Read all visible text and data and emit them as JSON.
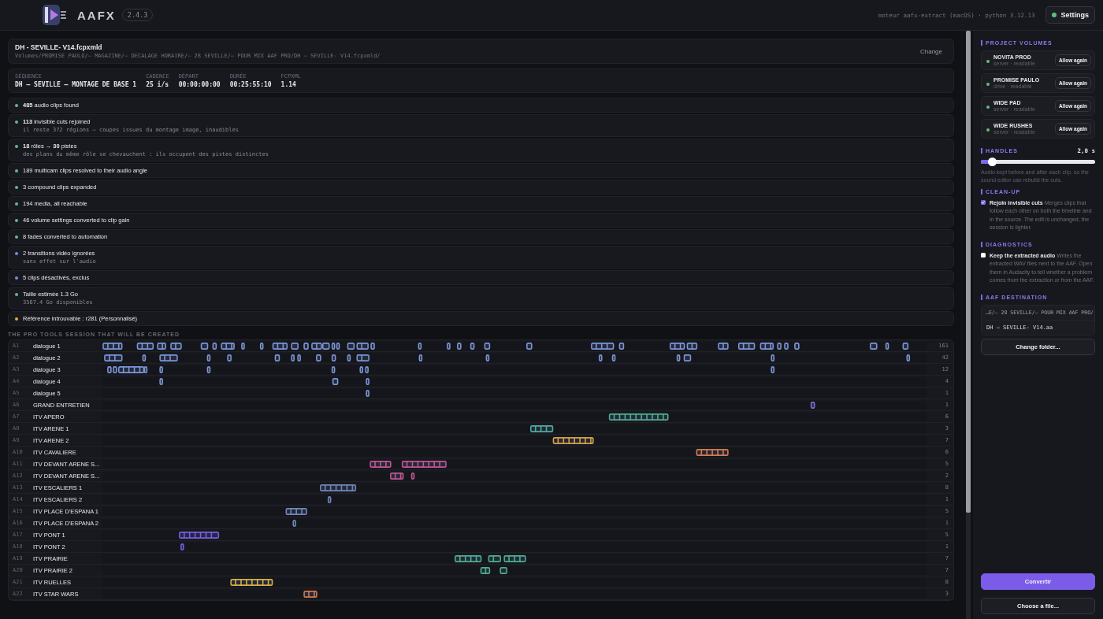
{
  "header": {
    "app_name": "AAFX",
    "version": "2.4.3",
    "engine": "moteur aafx-extract (macOS) · python 3.12.13",
    "settings": {
      "label": "Settings",
      "color": "#5fbf7f"
    }
  },
  "file": {
    "name": "DH - SEVILLE- V14.fcpxmld",
    "path": "Volumes/PROMISE PAULO/— MAGAZINE/— DECALAGE HORAIRE/— 28 SEVILLE/— POUR MIX AAF PRO/DH — SEVILLE- V14.fcpxmld/",
    "change": "Change"
  },
  "sequence": [
    {
      "label": "SÉQUENCE",
      "value": "DH — SEVILLE — MONTAGE DE BASE 1"
    },
    {
      "label": "CADENCE",
      "value": "25 i/s"
    },
    {
      "label": "DÉPART",
      "value": "00:00:00:00"
    },
    {
      "label": "DURÉE",
      "value": "00:25:55:10"
    },
    {
      "label": "FCPXML",
      "value": "1.14"
    }
  ],
  "report": [
    {
      "text": "**485** audio clips found",
      "color": "#5fbf7f"
    },
    {
      "text": "**113** invisible cuts rejoined",
      "detail": "il reste 372 régions — coupes issues du montage image, inaudibles",
      "color": "#5fbf7f"
    },
    {
      "text": "**18** rôles → **30** pistes",
      "detail": "des plans du même rôle se chevauchent : ils occupent des pistes distinctes",
      "color": "#5fbf7f"
    },
    {
      "text": "189 multicam clips resolved to their audio angle",
      "color": "#5fbf7f"
    },
    {
      "text": "3 compound clips expanded",
      "color": "#5fbf7f"
    },
    {
      "text": "194 media, all reachable",
      "color": "#5fbf7f"
    },
    {
      "text": "46 volume settings converted to clip gain",
      "color": "#5fbf7f"
    },
    {
      "text": "8 fades converted to automation",
      "color": "#5fbf7f"
    },
    {
      "text": "2 transitions vidéo ignorées",
      "detail": "sans effet sur l'audio",
      "color": "#6f8fe0"
    },
    {
      "text": "5 clips désactivés, exclus",
      "color": "#6f8fe0"
    },
    {
      "text": "Taille estimée 1.3 Go",
      "detail": "3567.4 Go disponibles",
      "color": "#5fbf7f"
    },
    {
      "text": "Référence introuvable : r281 (Personnalisé)",
      "color": "#e0b040"
    }
  ],
  "session": {
    "title": "THE PRO TOOLS SESSION THAT WILL BE CREATED",
    "tracks": [
      {
        "id": "A1",
        "name": "dialogue 1",
        "count": "161",
        "color": "#7c96d8"
      },
      {
        "id": "A2",
        "name": "dialogue 2",
        "count": "42",
        "color": "#7c96d8"
      },
      {
        "id": "A3",
        "name": "dialogue 3",
        "count": "12",
        "color": "#7c96d8"
      },
      {
        "id": "A4",
        "name": "dialogue 4",
        "count": "4",
        "color": "#7c96d8"
      },
      {
        "id": "A5",
        "name": "dialogue 5",
        "count": "1",
        "color": "#7c96d8"
      },
      {
        "id": "A6",
        "name": "GRAND ENTRETIEN",
        "count": "1",
        "color": "#7a72d8"
      },
      {
        "id": "A7",
        "name": "ITV APERO",
        "count": "6",
        "color": "#4fae8c"
      },
      {
        "id": "A8",
        "name": "ITV ARENE 1",
        "count": "3",
        "color": "#4fae9a"
      },
      {
        "id": "A9",
        "name": "ITV ARENE 2",
        "count": "7",
        "color": "#d6a040"
      },
      {
        "id": "A10",
        "name": "ITV CAVALIERE",
        "count": "6",
        "color": "#d87a4a"
      },
      {
        "id": "A11",
        "name": "ITV DEVANT ARENE S...",
        "count": "5",
        "color": "#c4558e"
      },
      {
        "id": "A12",
        "name": "ITV DEVANT ARENE S...",
        "count": "2",
        "color": "#c4558e"
      },
      {
        "id": "A13",
        "name": "ITV ESCALIERS 1",
        "count": "8",
        "color": "#7088b8"
      },
      {
        "id": "A14",
        "name": "ITV ESCALIERS 2",
        "count": "1",
        "color": "#7088b8"
      },
      {
        "id": "A15",
        "name": "ITV PLACE D'ESPANA 1",
        "count": "5",
        "color": "#7088b8"
      },
      {
        "id": "A16",
        "name": "ITV PLACE D'ESPANA 2",
        "count": "1",
        "color": "#7088b8"
      },
      {
        "id": "A17",
        "name": "ITV PONT 1",
        "count": "5",
        "color": "#7a5ce8"
      },
      {
        "id": "A18",
        "name": "ITV PONT 2",
        "count": "1",
        "color": "#7a5ce8"
      },
      {
        "id": "A19",
        "name": "ITV PRAIRIE",
        "count": "7",
        "color": "#4fae8c"
      },
      {
        "id": "A20",
        "name": "ITV PRAIRIE 2",
        "count": "7",
        "color": "#4fae8c"
      },
      {
        "id": "A21",
        "name": "ITV RUELLES",
        "count": "8",
        "color": "#d6b040"
      },
      {
        "id": "A22",
        "name": "ITV STAR WARS",
        "count": "3",
        "color": "#d07a4a"
      }
    ]
  },
  "sidebar": {
    "volumes": {
      "title": "PROJECT VOLUMES",
      "items": [
        {
          "name": "NOVITA PROD",
          "detail": "server · readable",
          "action": "Allow again",
          "color": "#5fbf7f"
        },
        {
          "name": "PROMISE PAULO",
          "detail": "drive · readable",
          "action": "Allow again",
          "color": "#5fbf7f"
        },
        {
          "name": "WIDE PAD",
          "detail": "server · readable",
          "action": "Allow again",
          "color": "#5fbf7f"
        },
        {
          "name": "WIDE RUSHES",
          "detail": "server · readable",
          "action": "Allow again",
          "color": "#5fbf7f"
        }
      ]
    },
    "handles": {
      "title": "HANDLES",
      "reading": "2,0 s",
      "level": 0.1,
      "help": "Audio kept before and after each clip, so the sound editor can rebuild the cuts."
    },
    "cleanup": {
      "title": "CLEAN-UP",
      "label": "Rejoin invisible cuts",
      "help": "Merges clips that follow each other on both the timeline and in the source. The edit is unchanged, the session is lighter.",
      "checked": true
    },
    "diagnostics": {
      "title": "DIAGNOSTICS",
      "label": "Keep the extracted audio",
      "help": "Writes the extracted WAV files next to the AAF. Open them in Audacity to tell whether a problem comes from the extraction or from the AAF.",
      "checked": false
    },
    "destination": {
      "title": "AAF DESTINATION",
      "folder": "…E/— 28 SEVILLE/— POUR MIX AAF PRO/",
      "filename": "DH — SEVILLE- V14.aa",
      "change": "Change folder..."
    },
    "convert": "Convertir",
    "choose": "Choose a file..."
  }
}
